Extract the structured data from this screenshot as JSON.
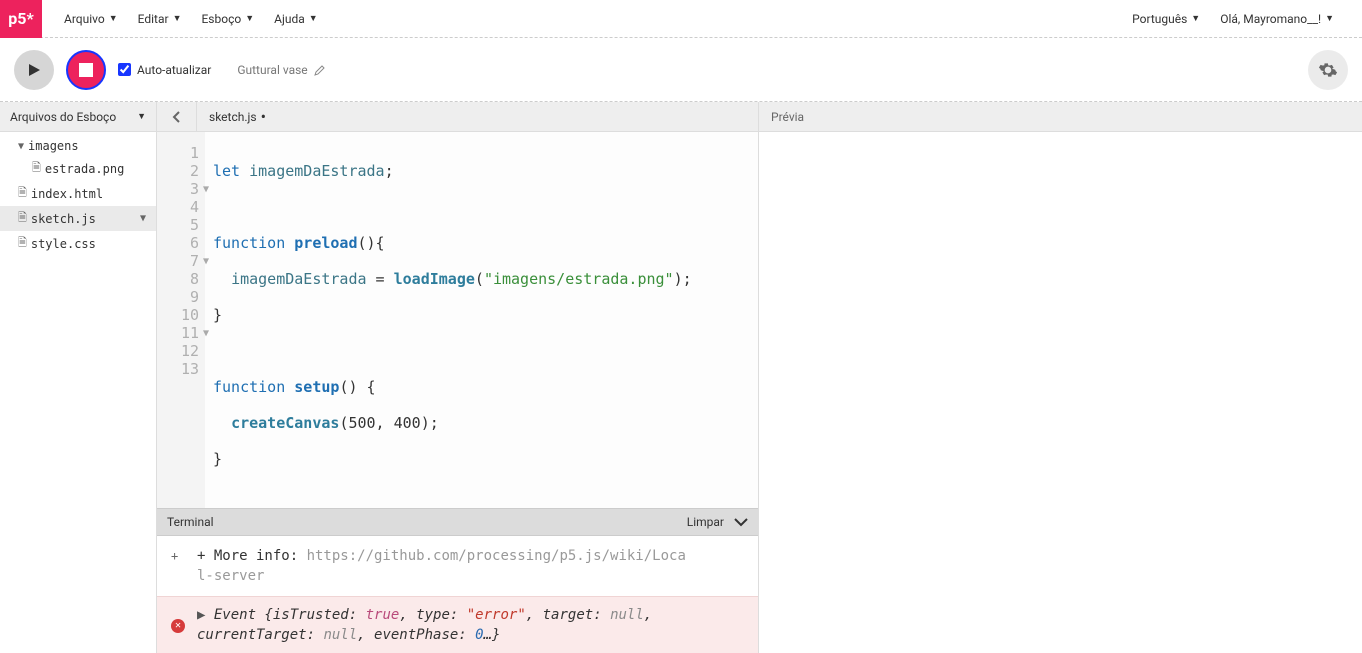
{
  "logo": "p5*",
  "nav": {
    "items": [
      "Arquivo",
      "Editar",
      "Esboço",
      "Ajuda"
    ],
    "right": [
      "Português",
      "Olá, Mayromano__!"
    ]
  },
  "toolbar": {
    "auto_refresh_label": "Auto-atualizar",
    "auto_refresh_checked": true,
    "project_name": "Guttural vase"
  },
  "sidebar": {
    "title": "Arquivos do Esboço",
    "items": [
      {
        "label": "imagens",
        "type": "folder",
        "indent": 0,
        "selected": false
      },
      {
        "label": "estrada.png",
        "type": "file",
        "indent": 1,
        "selected": false
      },
      {
        "label": "index.html",
        "type": "file",
        "indent": 0,
        "selected": false
      },
      {
        "label": "sketch.js",
        "type": "file",
        "indent": 0,
        "selected": true
      },
      {
        "label": "style.css",
        "type": "file",
        "indent": 0,
        "selected": false
      }
    ]
  },
  "editor": {
    "tab_name": "sketch.js",
    "modified": true,
    "line_count": 13,
    "folds": [
      3,
      7,
      11
    ],
    "highlighted_line": 13
  },
  "terminal": {
    "title": "Terminal",
    "clear_label": "Limpar",
    "info_prefix": "+ More info: ",
    "info_url": "https://github.com/processing/p5.js/wiki/Local-server",
    "error": {
      "prefix": "Event ",
      "parts": [
        {
          "k": "isTrusted",
          "v": "true",
          "t": "bool"
        },
        {
          "k": "type",
          "v": "\"error\"",
          "t": "str"
        },
        {
          "k": "target",
          "v": "null",
          "t": "null"
        },
        {
          "k": "currentTarget",
          "v": "null",
          "t": "null"
        },
        {
          "k": "eventPhase",
          "v": "0",
          "t": "num"
        }
      ]
    }
  },
  "preview": {
    "title": "Prévia"
  },
  "chart_data": null
}
